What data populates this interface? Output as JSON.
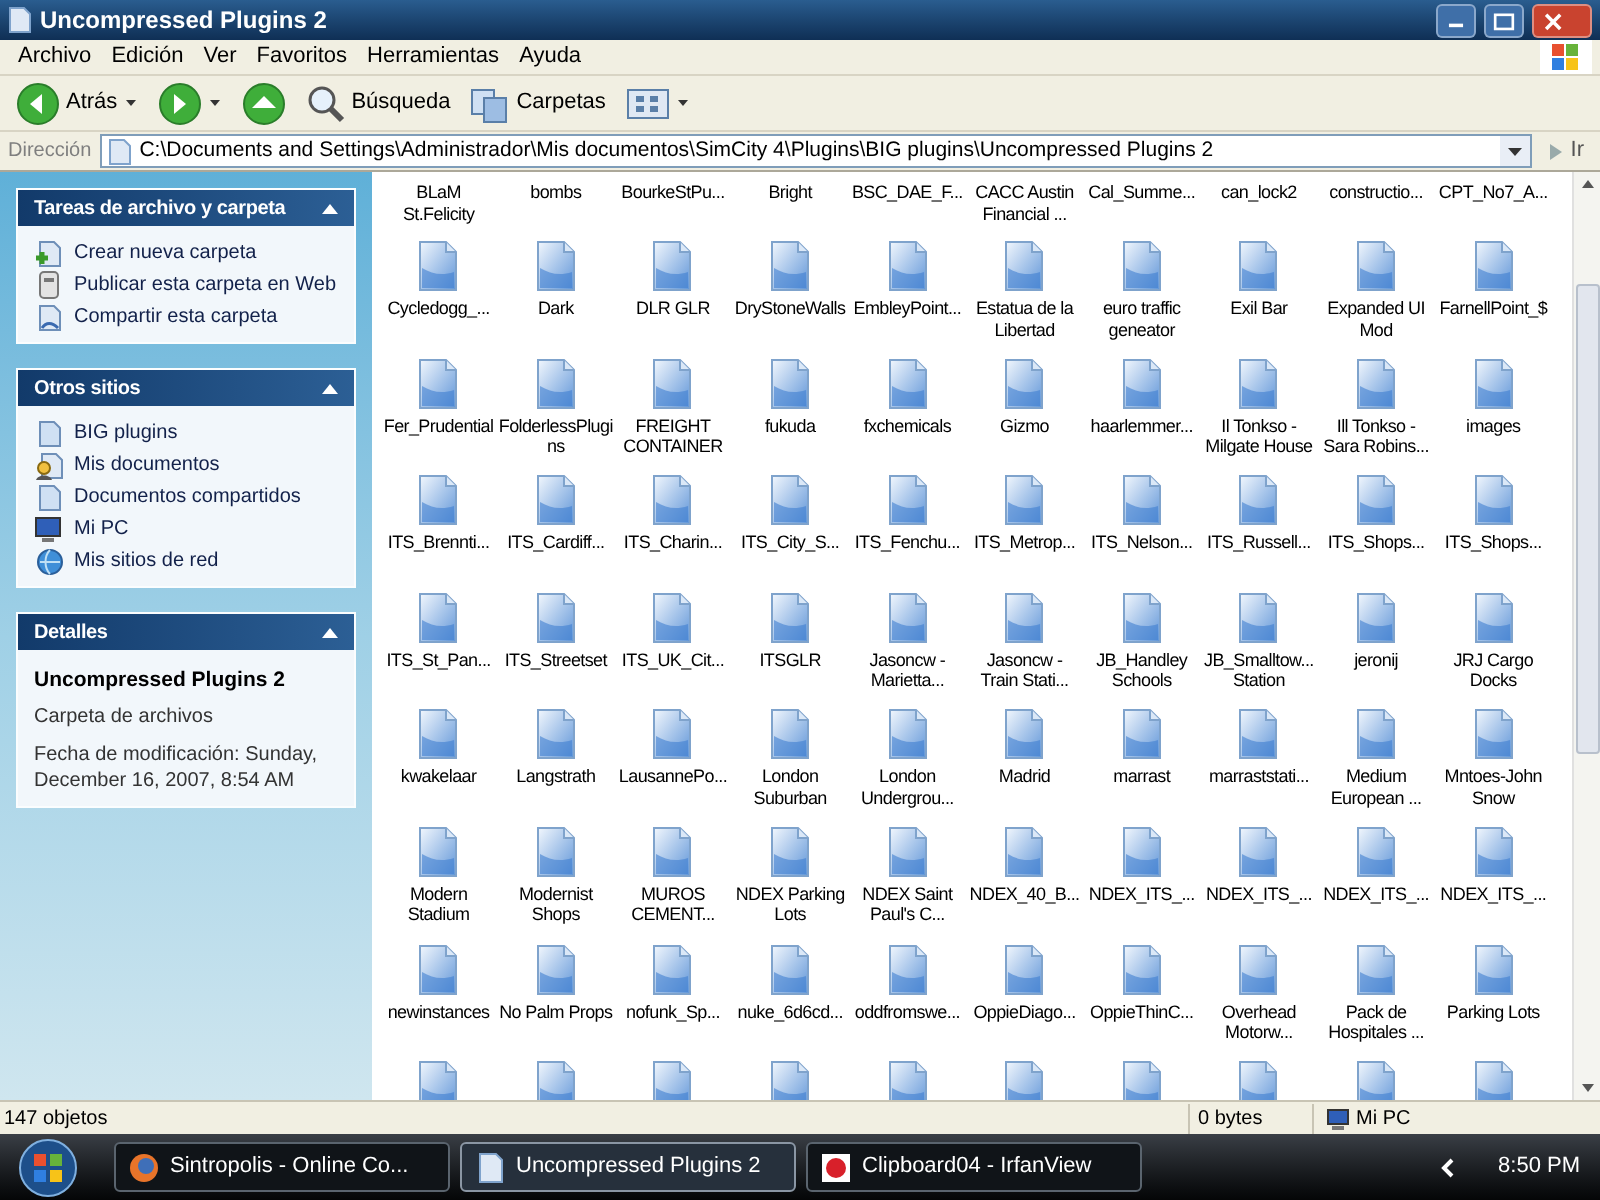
{
  "window": {
    "title": "Uncompressed Plugins 2"
  },
  "menu": [
    "Archivo",
    "Edición",
    "Ver",
    "Favoritos",
    "Herramientas",
    "Ayuda"
  ],
  "toolbar": [
    {
      "kind": "back",
      "label": "Atrás"
    },
    {
      "kind": "forward"
    },
    {
      "kind": "up"
    },
    {
      "kind": "search",
      "label": "Búsqueda"
    },
    {
      "kind": "folders",
      "label": "Carpetas"
    },
    {
      "kind": "views"
    }
  ],
  "address": {
    "label": "Dirección",
    "value": "C:\\Documents and Settings\\Administrador\\Mis documentos\\SimCity 4\\Plugins\\BIG plugins\\Uncompressed Plugins 2",
    "go": "Ir"
  },
  "sidebar": {
    "panels": [
      {
        "kind": "links",
        "title": "Tareas de archivo y carpeta",
        "items": [
          {
            "kind": "new-folder",
            "label": "Crear nueva carpeta"
          },
          {
            "kind": "publish",
            "label": "Publicar esta carpeta en Web"
          },
          {
            "kind": "share",
            "label": "Compartir esta carpeta"
          }
        ]
      },
      {
        "kind": "links",
        "title": "Otros sitios",
        "items": [
          {
            "kind": "folder",
            "label": "BIG plugins"
          },
          {
            "kind": "documents",
            "label": "Mis documentos"
          },
          {
            "kind": "folder",
            "label": "Documentos compartidos"
          },
          {
            "kind": "computer",
            "label": "Mi PC"
          },
          {
            "kind": "network",
            "label": "Mis sitios de red"
          }
        ]
      },
      {
        "kind": "details",
        "title": "Detalles",
        "name": "Uncompressed Plugins 2",
        "type": "Carpeta de archivos",
        "modified": "Fecha de modificación: Sunday, December 16, 2007, 8:54 AM"
      }
    ]
  },
  "files": {
    "first_row_cut": true,
    "rows": [
      [
        "BLaM St.Felicity",
        "bombs",
        "BourkeStPu...",
        "Bright",
        "BSC_DAE_F...",
        "CACC Austin Financial ...",
        "Cal_Summe...",
        "can_lock2",
        "constructio...",
        "CPT_No7_A..."
      ],
      [
        "Cycledogg_...",
        "Dark",
        "DLR GLR",
        "DryStoneWalls",
        "EmbleyPoint...",
        "Estatua de la Libertad",
        "euro traffic geneator",
        "Exil Bar",
        "Expanded UI Mod",
        "FarnellPoint_$"
      ],
      [
        "Fer_Prudential",
        "FolderlessPlugins",
        "FREIGHT CONTAINER",
        "fukuda",
        "fxchemicals",
        "Gizmo",
        "haarlemmer...",
        "Il Tonkso - Milgate House",
        "Ill Tonkso - Sara Robins...",
        "images"
      ],
      [
        "ITS_Brennti...",
        "ITS_Cardiff...",
        "ITS_Charin...",
        "ITS_City_S...",
        "ITS_Fenchu...",
        "ITS_Metrop...",
        "ITS_Nelson...",
        "ITS_Russell...",
        "ITS_Shops...",
        "ITS_Shops..."
      ],
      [
        "ITS_St_Pan...",
        "ITS_Streetset",
        "ITS_UK_Cit...",
        "ITSGLR",
        "Jasoncw - Marietta...",
        "Jasoncw - Train Stati...",
        "JB_Handley Schools",
        "JB_Smalltow... Station",
        "jeronij",
        "JRJ Cargo Docks"
      ],
      [
        "kwakelaar",
        "Langstrath",
        "LausannePo...",
        "London Suburban",
        "London Undergrou...",
        "Madrid",
        "marrast",
        "marraststati...",
        "Medium European ...",
        "Mntoes-John Snow"
      ],
      [
        "Modern Stadium",
        "Modernist Shops",
        "MUROS CEMENT...",
        "NDEX Parking Lots",
        "NDEX Saint Paul's C...",
        "NDEX_40_B...",
        "NDEX_ITS_...",
        "NDEX_ITS_...",
        "NDEX_ITS_...",
        "NDEX_ITS_..."
      ],
      [
        "newinstances",
        "No Palm Props",
        "nofunk_Sp...",
        "nuke_6d6cd...",
        "oddfromswe...",
        "OppieDiago...",
        "OppieThinC...",
        "Overhead Motorw...",
        "Pack de Hospitales ...",
        "Parking Lots"
      ]
    ],
    "bottom_row_icons": [
      {
        "kind": "file"
      },
      {
        "kind": "file"
      },
      {
        "kind": "file"
      },
      {
        "kind": "file"
      },
      {
        "kind": "file"
      },
      {
        "kind": "file"
      },
      {
        "kind": "file"
      },
      {
        "kind": "file"
      },
      {
        "kind": "file"
      },
      {
        "kind": "file"
      }
    ]
  },
  "status_bar": {
    "count": "147 objetos",
    "size": "0 bytes",
    "location": "Mi PC"
  },
  "taskbar": {
    "buttons": [
      {
        "kind": "browser",
        "label": "Sintropolis - Online Co...",
        "selected": false
      },
      {
        "kind": "explorer",
        "label": "Uncompressed Plugins 2",
        "selected": true
      },
      {
        "kind": "viewer",
        "label": "Clipboard04 - IrfanView",
        "selected": false
      }
    ],
    "clock": "8:50 PM"
  }
}
